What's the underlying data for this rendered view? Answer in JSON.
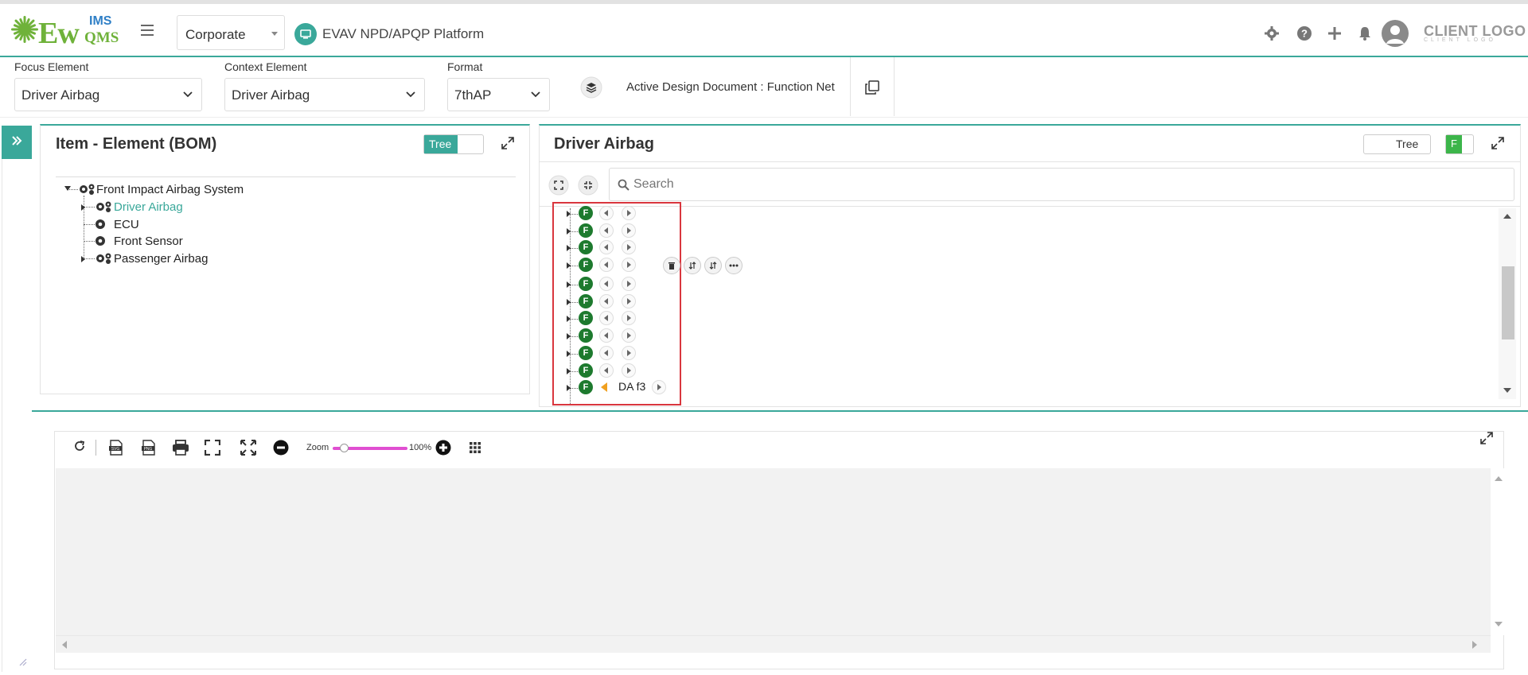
{
  "app": {
    "logo_main": "Ew",
    "logo_ims": "IMS",
    "logo_qms": "QMS",
    "org_select": "Corporate",
    "platform_title": "EVAV NPD/APQP Platform",
    "client_logo": "CLIENT LOGO",
    "client_logo_sub": "CLIENT LOGO"
  },
  "filters": {
    "focus_label": "Focus Element",
    "focus_value": "Driver Airbag",
    "context_label": "Context Element",
    "context_value": "Driver Airbag",
    "format_label": "Format",
    "format_value": "7thAP",
    "active_doc": "Active Design Document : Function Net"
  },
  "left_panel": {
    "title": "Item - Element (BOM)",
    "toggle_label": "Tree",
    "tree": [
      {
        "label": "Front Impact Airbag System",
        "level": 0,
        "expanded": true
      },
      {
        "label": "Driver Airbag",
        "level": 1,
        "active": true
      },
      {
        "label": "ECU",
        "level": 1
      },
      {
        "label": "Front Sensor",
        "level": 1
      },
      {
        "label": "Passenger Airbag",
        "level": 1
      }
    ]
  },
  "right_panel": {
    "title": "Driver Airbag",
    "toggle_label": "Tree",
    "toggle_badge": "F",
    "search_placeholder": "Search",
    "badge_letter": "F",
    "row_count": 12,
    "last_row_label": "DA f3"
  },
  "bottom_toolbar": {
    "zoom_label": "Zoom",
    "zoom_value": "100%",
    "zoom_level": 0.15
  },
  "colors": {
    "accent": "#3aa89a",
    "badge_green": "#1d7a2e",
    "highlight_red": "#d9363e",
    "zoom_pink": "#e04fd1"
  }
}
